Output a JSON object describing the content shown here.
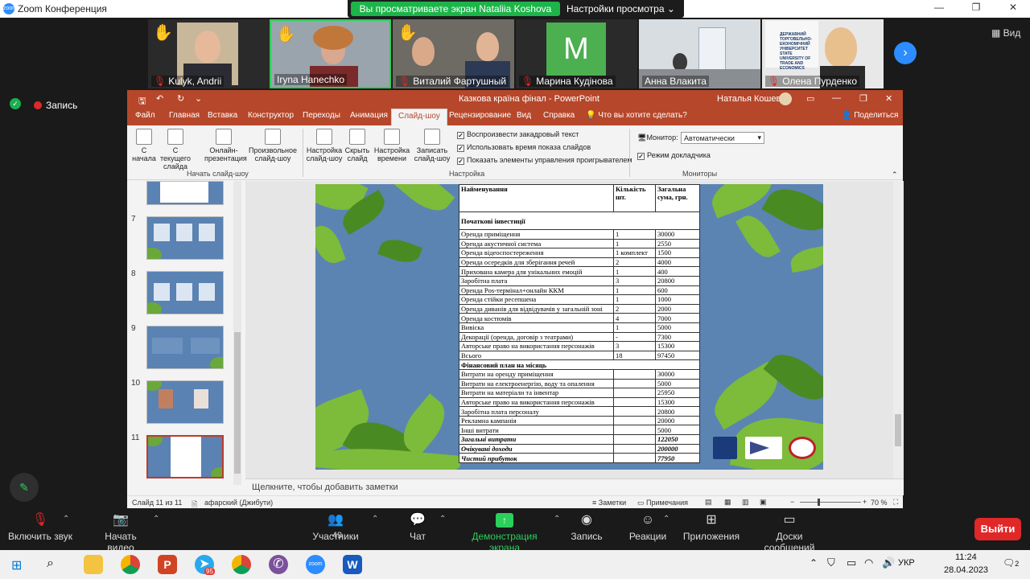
{
  "window": {
    "title": "Zoom Конференция"
  },
  "sharebar": {
    "viewing": "Вы просматриваете экран Nataliia Koshova",
    "options": "Настройки просмотра"
  },
  "view_label": "Вид",
  "recording_label": "Запись",
  "participants": [
    {
      "name": "Kulyk, Andrii",
      "muted": true,
      "hand": true
    },
    {
      "name": "Iryna Hanechko",
      "muted": false,
      "hand": true
    },
    {
      "name": "Виталий Фартушный",
      "muted": true,
      "hand": true
    },
    {
      "name": "Марина Кудінова",
      "muted": true,
      "hand": false,
      "initial": "M"
    },
    {
      "name": "Анна Влакита",
      "muted": false,
      "hand": false
    },
    {
      "name": "Олена Пурденко",
      "muted": true,
      "hand": false,
      "logo_text": "ДЕРЖАВНИЙ ТОРГОВЕЛЬНО-ЕКОНОМІЧНИЙ УНІВЕРСИТЕТ STATE UNIVERSITY OF TRADE AND ECONOMICS"
    }
  ],
  "ppt": {
    "title": "Казкова країна фінал - PowerPoint",
    "user": "Наталья Кошевая",
    "tabs": [
      "Файл",
      "Главная",
      "Вставка",
      "Конструктор",
      "Переходы",
      "Анимация",
      "Слайд-шоу",
      "Рецензирование",
      "Вид",
      "Справка"
    ],
    "tell_me": "Что вы хотите сделать?",
    "share": "Поделиться",
    "ribbon": {
      "from_start": "С начала",
      "from_current": "С текущего слайда",
      "online": "Онлайн-презентация",
      "custom": "Произвольное слайд-шоу",
      "group_start": "Начать слайд-шоу",
      "setup": "Настройка слайд-шоу",
      "hide": "Скрыть слайд",
      "timing": "Настройка времени",
      "record": "Записать слайд-шоу",
      "chk_narration": "Воспроизвести закадровый текст",
      "chk_timing": "Использовать время показа слайдов",
      "chk_controls": "Показать элементы управления проигрывателем",
      "group_setup": "Настройка",
      "monitor_label": "Монитор:",
      "monitor_value": "Автоматически",
      "presenter": "Режим докладчика",
      "group_monitors": "Мониторы"
    },
    "slide_numbers": [
      "7",
      "8",
      "9",
      "10",
      "11"
    ],
    "notes_placeholder": "Щелкните, чтобы добавить заметки",
    "status": {
      "slide": "Слайд 11 из 11",
      "lang": "афарский (Джибути)",
      "notes": "Заметки",
      "comments": "Примечания",
      "zoom": "70 %"
    }
  },
  "table": {
    "headers": [
      "Найменування",
      "Кількість шт.",
      "Загальна сума, грн."
    ],
    "section1": "Початкові інвестиції",
    "rows1": [
      [
        "Оренда приміщення",
        "1",
        "30000"
      ],
      [
        "Оренда акустичної система",
        "1",
        "2550"
      ],
      [
        "Оренда відеоспостереження",
        "1 комплект",
        "1500"
      ],
      [
        "Оренда осередків для зберігання речей",
        "2",
        "4000"
      ],
      [
        "Прихована камера для унікальних емоцій",
        "1",
        "400"
      ],
      [
        "Заробітна плата",
        "3",
        "20800"
      ],
      [
        "Оренда Pos-термінал+онлайн ККМ",
        "1",
        "600"
      ],
      [
        "Оренда стійки ресепшена",
        "1",
        "1000"
      ],
      [
        "Оренда диванів для відвідувачів у загальній зоні",
        "2",
        "2000"
      ],
      [
        "Оренда костюмів",
        "4",
        "7000"
      ],
      [
        "Вивіска",
        "1",
        "5000"
      ],
      [
        "Декорації (оренда, договір з театрами)",
        "-",
        "7300"
      ],
      [
        "Авторське право на використання персонажів",
        "3",
        "15300"
      ],
      [
        "Всього",
        "18",
        "97450"
      ]
    ],
    "section2": "Фінансовий план на місяць",
    "rows2": [
      [
        "Витрати на оренду приміщення",
        "",
        "30000"
      ],
      [
        "Витрати на електроенергію, воду та опалення",
        "",
        "5000"
      ],
      [
        "Витрати на матеріали та інвентар",
        "",
        "25950"
      ],
      [
        "Авторське право на використання персонажів",
        "",
        "15300"
      ],
      [
        "Заробітна плата персоналу",
        "",
        "20800"
      ],
      [
        "Рекламна кампанія",
        "",
        "20000"
      ],
      [
        "Інші витрати",
        "",
        "5000"
      ]
    ],
    "totals": [
      [
        "Загальні витрати",
        "",
        "122050"
      ],
      [
        "Очікувані доходи",
        "",
        "200000"
      ],
      [
        "Чистий прибуток",
        "",
        "77950"
      ]
    ]
  },
  "toolbar": {
    "audio": "Включить звук",
    "video": "Начать видео",
    "participants": "Участники",
    "participants_count": "49",
    "chat": "Чат",
    "share": "Демонстрация экрана",
    "record": "Запись",
    "reactions": "Реакции",
    "apps": "Приложения",
    "boards": "Доски сообщений",
    "leave": "Выйти"
  },
  "taskbar": {
    "lang": "УКР",
    "time": "11:24",
    "date": "28.04.2023",
    "telegram_badge": "95",
    "notif": "2"
  }
}
